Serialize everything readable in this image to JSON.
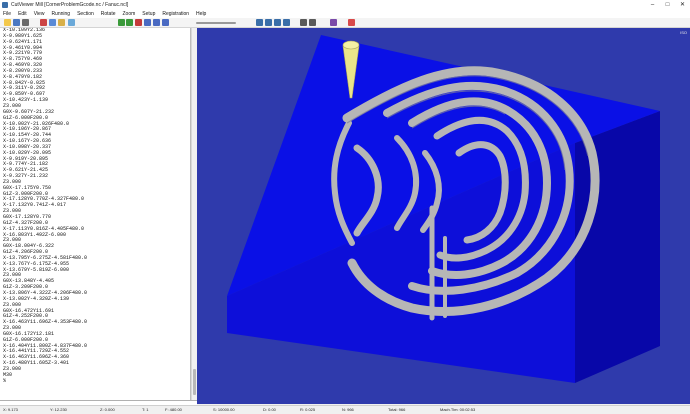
{
  "window": {
    "title": "CutViewer Mill [CornerProblemGcode.nc / Fanuc.ncl]",
    "minimize": "–",
    "maximize": "□",
    "close": "✕"
  },
  "menu": [
    "File",
    "Edit",
    "View",
    "Running",
    "Section",
    "Rotate",
    "Zoom",
    "Setup",
    "Registration",
    "Help"
  ],
  "toolbar_icons": [
    "open-icon",
    "save-icon",
    "print-icon",
    "cut-icon",
    "copy-icon",
    "paste-icon",
    "undo-icon",
    "play-icon",
    "step-icon",
    "stop-icon",
    "pause-icon",
    "rewind-icon",
    "forward-icon",
    "speed-slider-icon",
    "isometric-icon",
    "top-view-icon",
    "front-view-icon",
    "side-view-icon",
    "zoom-in-icon",
    "zoom-out-icon",
    "measure-icon",
    "color-icon"
  ],
  "gcode_lines": [
    "X-10.109Y2.136",
    "X-9.989Y1.625",
    "X-9.624Y1.171",
    "X-9.461Y0.994",
    "X-9.221Y0.779",
    "X-8.757Y0.469",
    "X-8.469Y0.320",
    "X-8.200Y0.233",
    "X-8.479Y0.182",
    "X-8.842Y-0.025",
    "X-9.311Y-0.292",
    "X-9.859Y-0.697",
    "X-10.423Y-1.139",
    "Z3.000",
    "G0X-9.607Y-21.232",
    "G1Z-6.000F200.0",
    "X-10.002Y-21.026F480.0",
    "X-10.106Y-20.867",
    "X-10.154Y-20.744",
    "X-10.167Y-20.636",
    "X-10.098Y-20.337",
    "X-10.029Y-20.095",
    "X-9.919Y-20.895",
    "X-9.774Y-21.182",
    "X-9.621Y-21.425",
    "X-9.327Y-21.232",
    "Z3.000",
    "G0X-17.175Y0.750",
    "G1Z-3.000F200.0",
    "X-17.128Y0.770Z-4.327F480.0",
    "X-17.132Y0.741Z-4.017",
    "Z3.000",
    "G0X-17.128Y0.770",
    "G1Z-4.327F200.0",
    "X-17.113Y0.816Z-4.405F480.0",
    "X-16.803Y1.492Z-6.000",
    "Z3.000",
    "G0X-18.004Y-6.322",
    "G1Z-4.206F200.0",
    "X-13.795Y-6.275Z-4.581F480.0",
    "X-13.767Y-6.175Z-4.955",
    "X-13.679Y-5.819Z-6.000",
    "Z3.000",
    "G0X-13.848Y-4.405",
    "G1Z-3.209F200.0",
    "X-13.806Y-4.322Z-4.206F480.0",
    "X-13.002Y-4.320Z-4.139",
    "Z3.000",
    "G0X-16.472Y11.691",
    "G1Z-4.252F200.0",
    "X-16.463Y11.696Z-4.353F480.0",
    "Z3.000",
    "G0X-16.172Y12.181",
    "G1Z-6.000F200.0",
    "X-16.404Y11.800Z-4.837F480.0",
    "X-16.441Y11.729Z-4.552",
    "X-16.463Y11.696Z-4.360",
    "X-16.480Y11.605Z-3.401",
    "Z3.000",
    "M30",
    "%"
  ],
  "status": {
    "x": "X: 9.173",
    "y": "Y: 12.230",
    "z": "Z: 0.000",
    "t": "T: 1",
    "f": "F: 480.00",
    "s": "S: 10000.00",
    "d": "D: 0.00",
    "r": "R: 0.025",
    "n": "N: 966",
    "total": "Total: 966",
    "mach_time": "Mach.Tim: 00:02:53"
  },
  "viewport": {
    "corner_label": "ISO",
    "background_color": "#2f3aac",
    "stock_top_color": "#0a10e6",
    "stock_front_color": "#0d0fd9",
    "stock_side_color": "#0807a8",
    "groove_color": "#b6b6b6",
    "tool_color": "#e9e48a"
  }
}
